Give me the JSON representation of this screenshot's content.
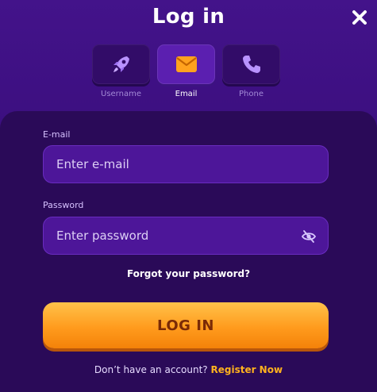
{
  "modal": {
    "title": "Log in"
  },
  "tabs": [
    {
      "label": "Username",
      "icon": "rocket-icon",
      "active": false
    },
    {
      "label": "Email",
      "icon": "envelope-icon",
      "active": true
    },
    {
      "label": "Phone",
      "icon": "phone-icon",
      "active": false
    }
  ],
  "form": {
    "email_label": "E-mail",
    "email_placeholder": "Enter e-mail",
    "password_label": "Password",
    "password_placeholder": "Enter password",
    "forgot": "Forgot your password?",
    "login_button": "LOG IN",
    "no_account": "Don’t have an account?",
    "register": "Register Now"
  },
  "colors": {
    "background": "#3a0f75",
    "panel": "#2a0a58",
    "field": "#4d1699",
    "accent_orange": "#ff9b1d",
    "link_yellow": "#ffb21e"
  }
}
